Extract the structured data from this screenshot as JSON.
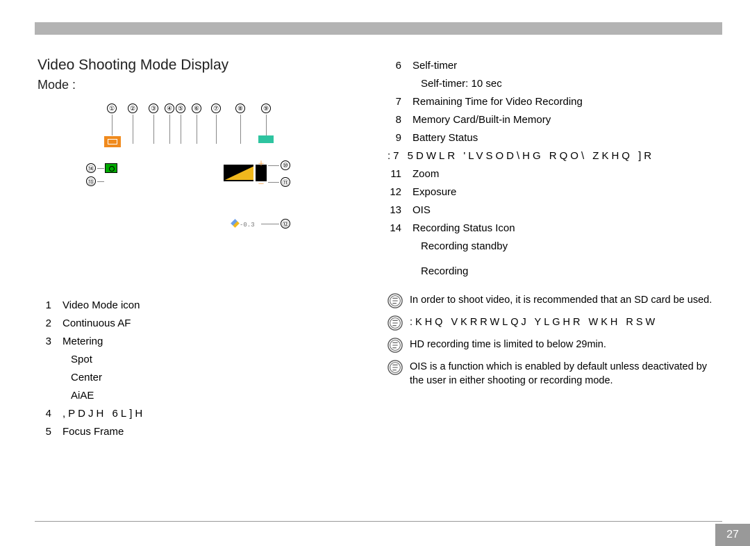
{
  "page_number": "27",
  "title": "Video Shooting Mode Display",
  "subtitle": "Mode :",
  "callouts": [
    "①",
    "②",
    "③",
    "④",
    "⑤",
    "⑥",
    "⑦",
    "⑧",
    "⑨",
    "⑩",
    "⑪",
    "⑫",
    "⑬",
    "⑭"
  ],
  "exposure_readout": "-0.3",
  "left_legend": [
    {
      "n": "1",
      "t": "Video Mode icon"
    },
    {
      "n": "2",
      "t": "Continuous AF"
    },
    {
      "n": "3",
      "t": "Metering"
    }
  ],
  "metering_sub": [
    "Spot",
    "Center",
    "AiAE"
  ],
  "left_legend2": [
    {
      "n": "4",
      "t": ",PDJH 6L]H"
    },
    {
      "n": "5",
      "t": "Focus Frame"
    }
  ],
  "right_legend": [
    {
      "n": "6",
      "t": "Self-timer"
    }
  ],
  "selftimer_sub": "Self-timer: 10 sec",
  "right_legend2": [
    {
      "n": "7",
      "t": "Remaining Time for Video Recording"
    },
    {
      "n": "8",
      "t": "Memory Card/Built-in Memory"
    },
    {
      "n": "9",
      "t": "Battery Status"
    }
  ],
  "item10": ":7 5DWLR  'LVSOD\\HG RQO\\ ZKHQ ]R",
  "right_legend3": [
    {
      "n": "11",
      "t": "Zoom"
    },
    {
      "n": "12",
      "t": "Exposure"
    },
    {
      "n": "13",
      "t": "OIS"
    },
    {
      "n": "14",
      "t": "Recording Status Icon"
    }
  ],
  "recording_sub": [
    "Recording standby",
    "Recording"
  ],
  "notes": [
    "In order to shoot video, it is recommended that an SD card be used.",
    ":KHQ VKRRWLQJ YLGHR  WKH RSW",
    "HD recording time is limited to below 29min.",
    "OIS is a function which is enabled by default unless deactivated by the user in either shooting or recording mode."
  ]
}
